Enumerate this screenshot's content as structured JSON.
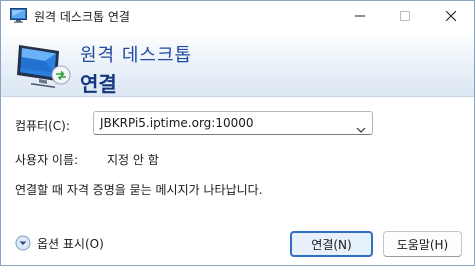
{
  "window": {
    "title": "원격 데스크톱 연결",
    "app_icon": "remote-desktop-icon",
    "controls": {
      "minimize_icon": "minimize-icon",
      "maximize_icon": "maximize-icon",
      "close_icon": "close-icon"
    }
  },
  "banner": {
    "title": "원격 데스크톱",
    "subtitle": "연결",
    "logo_icon": "remote-desktop-monitor-icon"
  },
  "form": {
    "computer_label": "컴퓨터(C):",
    "computer_value": "JBKRPi5.iptime.org:10000",
    "username_label": "사용자 이름:",
    "username_value": "지정 안 함",
    "notice": "연결할 때 자격 증명을 묻는 메시지가 나타납니다."
  },
  "footer": {
    "options_label": "옵션 표시(O)",
    "options_icon": "chevron-down-circle-icon",
    "connect_label": "연결(N)",
    "help_label": "도움말(H)"
  },
  "colors": {
    "accent": "#2f6fc4",
    "banner_title": "#1f4aa0",
    "banner_subtitle": "#13377e"
  }
}
